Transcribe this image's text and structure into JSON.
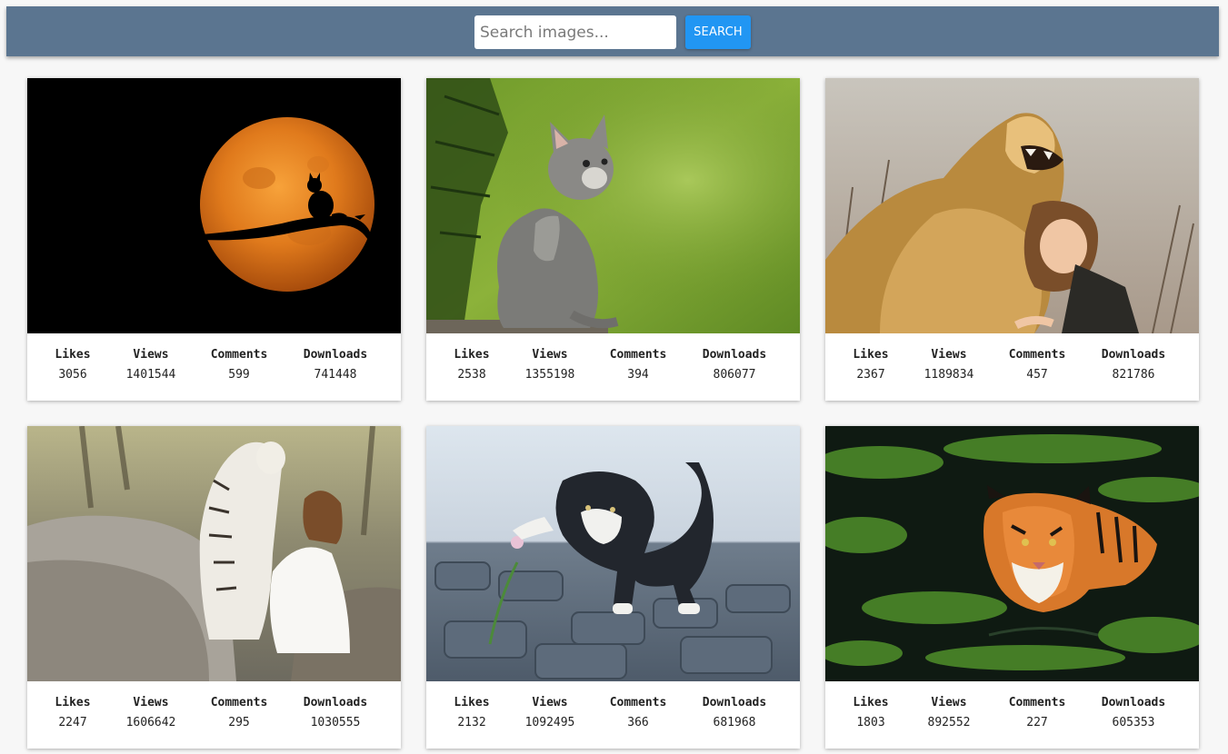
{
  "search": {
    "placeholder": "Search images...",
    "button_label": "SEARCH"
  },
  "stat_labels": {
    "likes": "Likes",
    "views": "Views",
    "comments": "Comments",
    "downloads": "Downloads"
  },
  "cards": [
    {
      "subject": "cat silhouette on orange moon",
      "likes": "3056",
      "views": "1401544",
      "comments": "599",
      "downloads": "741448"
    },
    {
      "subject": "grey kitten in forest",
      "likes": "2538",
      "views": "1355198",
      "comments": "394",
      "downloads": "806077"
    },
    {
      "subject": "lion with laughing girl",
      "likes": "2367",
      "views": "1189834",
      "comments": "457",
      "downloads": "821786"
    },
    {
      "subject": "white tiger with woman in white dress",
      "likes": "2247",
      "views": "1606642",
      "comments": "295",
      "downloads": "1030555"
    },
    {
      "subject": "kitten playing with flower",
      "likes": "2132",
      "views": "1092495",
      "comments": "366",
      "downloads": "681968"
    },
    {
      "subject": "tiger in green water",
      "likes": "1803",
      "views": "892552",
      "comments": "227",
      "downloads": "605353"
    }
  ]
}
